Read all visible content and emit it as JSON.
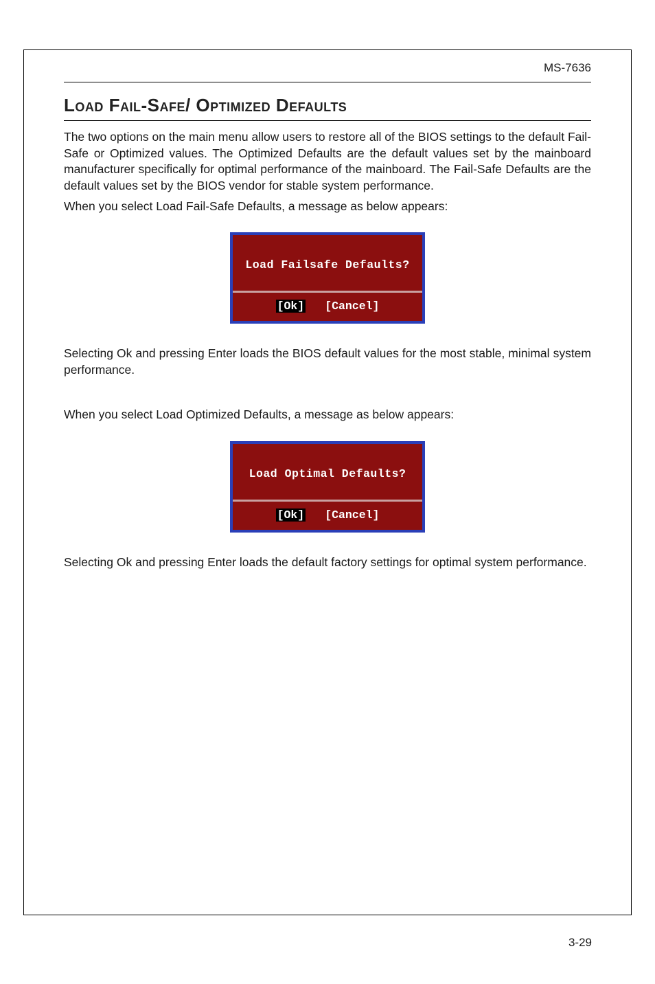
{
  "document_label": "MS-7636",
  "page_number": "3-29",
  "heading": "Load Fail-Safe/ Optimized Defaults",
  "para1": "The two options on the main menu allow users to restore all of the BIOS settings to the default Fail-Safe or Optimized values. The Optimized Defaults are the default values set by the mainboard manufacturer specifically for optimal performance of the mainboard. The Fail-Safe Defaults are the default values set by the BIOS vendor for stable system performance.",
  "para2": "When you select Load Fail-Safe Defaults, a message as below appears:",
  "dialog1": {
    "message": "Load Failsafe Defaults?",
    "ok": "[Ok]",
    "cancel": "[Cancel]"
  },
  "para3": "Selecting Ok and pressing Enter loads the BIOS default values for the most stable, minimal system performance.",
  "para4": "When you select Load Optimized Defaults, a message as below appears:",
  "dialog2": {
    "message": "Load Optimal Defaults?",
    "ok": "[Ok]",
    "cancel": "[Cancel]"
  },
  "para5": "Selecting Ok and pressing Enter loads the default factory settings for optimal system performance."
}
